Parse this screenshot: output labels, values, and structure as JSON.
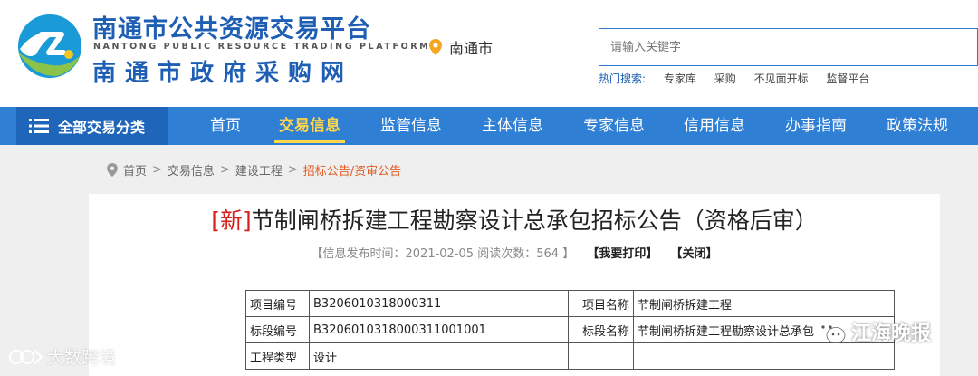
{
  "header": {
    "brand_cn": "南通市公共资源交易平台",
    "brand_en": "NANTONG PUBLIC RESOURCE TRADING PLATFORM",
    "brand_sub": "南通市政府采购网",
    "location": "南通市",
    "search_placeholder": "请输入关键字",
    "hot_label": "热门搜索:",
    "hot_keywords": [
      "专家库",
      "采购",
      "不见面开标",
      "监督平台"
    ]
  },
  "nav": {
    "all_label": "全部交易分类",
    "items": [
      "首页",
      "交易信息",
      "监管信息",
      "主体信息",
      "专家信息",
      "信用信息",
      "办事指南",
      "政策法规"
    ],
    "active_index": 1
  },
  "breadcrumb": [
    "首页",
    "交易信息",
    "建设工程",
    "招标公告/资审公告"
  ],
  "article": {
    "new_tag": "[新]",
    "title": "节制闸桥拆建工程勘察设计总承包招标公告（资格后审）",
    "meta_prefix": "【信息发布时间：",
    "publish_date": "2021-02-05",
    "views_label": "阅读次数：",
    "views": "564",
    "meta_suffix": "】",
    "print_label": "【我要打印】",
    "close_label": "【关闭】"
  },
  "table": {
    "rows": [
      [
        "项目编号",
        "B3206010318000311",
        "项目名称",
        "节制闸桥拆建工程"
      ],
      [
        "标段编号",
        "B3206010318000311001001",
        "标段名称",
        "节制闸桥拆建工程勘察设计总承包"
      ],
      [
        "工程类型",
        "设计",
        "",
        ""
      ]
    ]
  },
  "watermarks": {
    "left": "大数跨境",
    "right": "江海晚报"
  },
  "colors": {
    "brand_blue": "#1e5fb4",
    "nav_blue": "#2f7fd4",
    "nav_active": "#ffd54a",
    "breadcrumb_current": "#e05a22",
    "new_tag": "#d8201f"
  }
}
